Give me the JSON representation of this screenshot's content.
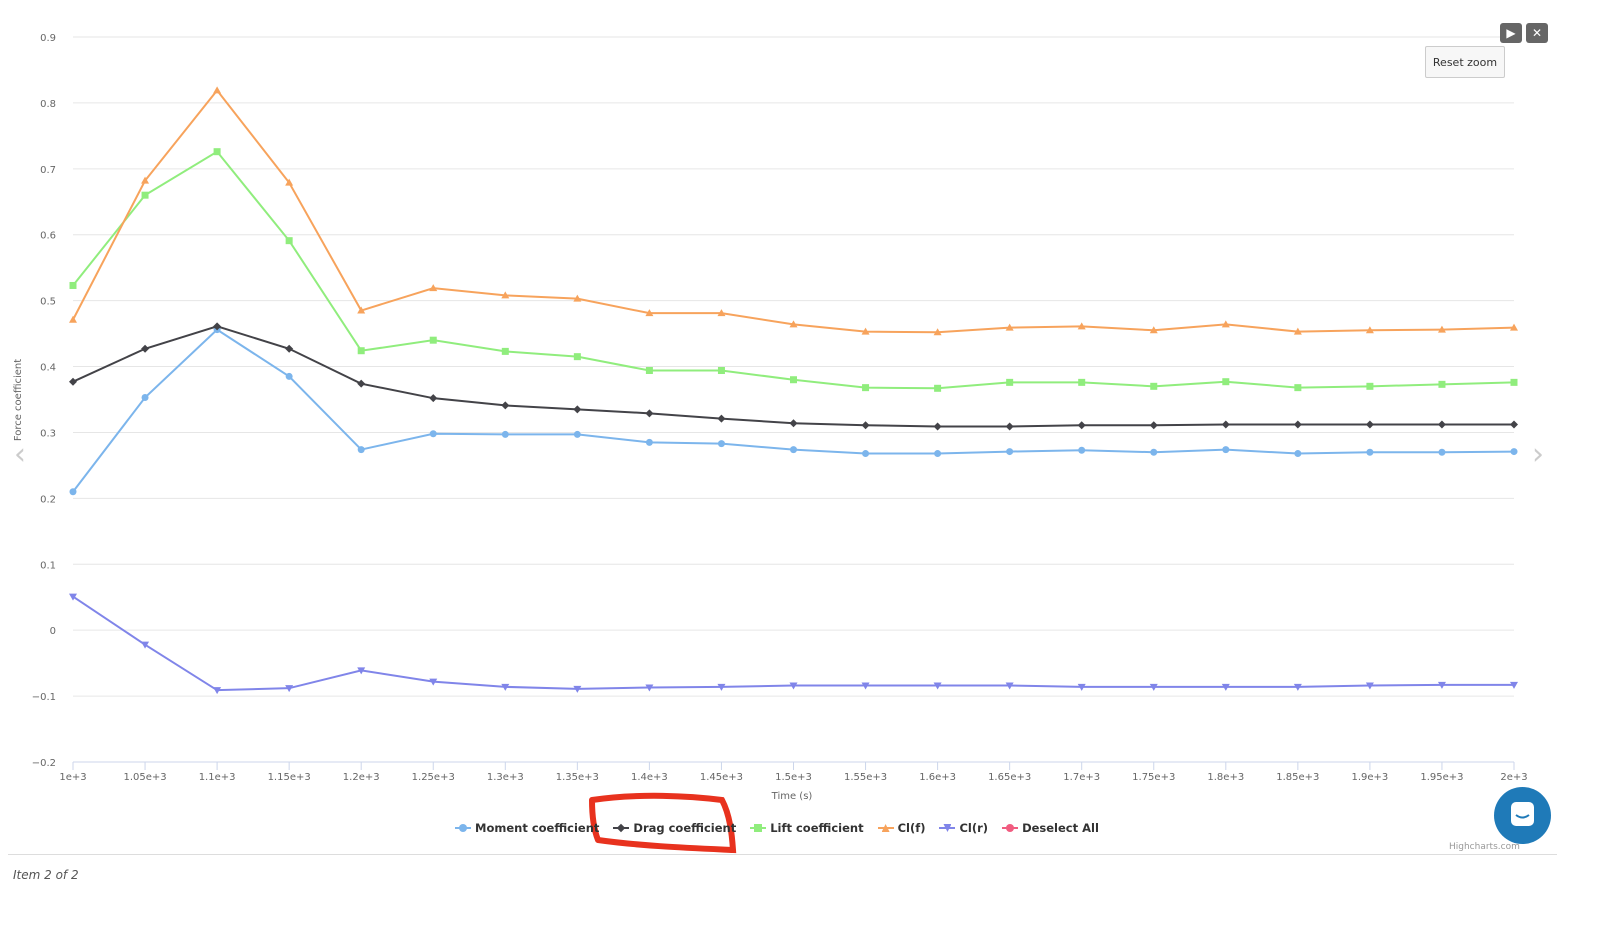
{
  "chart_data": {
    "type": "line",
    "title": "",
    "xlabel": "Time (s)",
    "ylabel": "Force coefficient",
    "xlim": [
      1000,
      2000
    ],
    "ylim": [
      -0.2,
      0.9
    ],
    "yticks": [
      -0.2,
      -0.1,
      0,
      0.1,
      0.2,
      0.3,
      0.4,
      0.5,
      0.6,
      0.7,
      0.8,
      0.9
    ],
    "ytick_labels": [
      "−0.2",
      "−0.1",
      "0",
      "0.1",
      "0.2",
      "0.3",
      "0.4",
      "0.5",
      "0.6",
      "0.7",
      "0.8",
      "0.9"
    ],
    "x": [
      1000,
      1050,
      1100,
      1150,
      1200,
      1250,
      1300,
      1350,
      1400,
      1450,
      1500,
      1550,
      1600,
      1650,
      1700,
      1750,
      1800,
      1850,
      1900,
      1950,
      2000
    ],
    "xtick_labels": [
      "1e+3",
      "1.05e+3",
      "1.1e+3",
      "1.15e+3",
      "1.2e+3",
      "1.25e+3",
      "1.3e+3",
      "1.35e+3",
      "1.4e+3",
      "1.45e+3",
      "1.5e+3",
      "1.55e+3",
      "1.6e+3",
      "1.65e+3",
      "1.7e+3",
      "1.75e+3",
      "1.8e+3",
      "1.85e+3",
      "1.9e+3",
      "1.95e+3",
      "2e+3"
    ],
    "grid": true,
    "legend_position": "bottom-center",
    "series": [
      {
        "name": "Moment coefficient",
        "color": "#7cb5ec",
        "marker": "circle",
        "values": [
          0.21,
          0.353,
          0.456,
          0.385,
          0.274,
          0.298,
          0.297,
          0.297,
          0.285,
          0.283,
          0.274,
          0.268,
          0.268,
          0.271,
          0.273,
          0.27,
          0.274,
          0.268,
          0.27,
          0.27,
          0.271
        ]
      },
      {
        "name": "Drag coefficient",
        "color": "#434348",
        "marker": "diamond",
        "values": [
          0.377,
          0.427,
          0.461,
          0.427,
          0.374,
          0.352,
          0.341,
          0.335,
          0.329,
          0.321,
          0.314,
          0.311,
          0.309,
          0.309,
          0.311,
          0.311,
          0.312,
          0.312,
          0.312,
          0.312,
          0.312
        ]
      },
      {
        "name": "Lift coefficient",
        "color": "#90ed7d",
        "marker": "square",
        "values": [
          0.523,
          0.66,
          0.726,
          0.591,
          0.424,
          0.44,
          0.423,
          0.415,
          0.394,
          0.394,
          0.38,
          0.368,
          0.367,
          0.376,
          0.376,
          0.37,
          0.377,
          0.368,
          0.37,
          0.373,
          0.376
        ]
      },
      {
        "name": "Cl(f)",
        "color": "#f7a35c",
        "marker": "triangle",
        "values": [
          0.471,
          0.682,
          0.819,
          0.679,
          0.485,
          0.519,
          0.508,
          0.503,
          0.481,
          0.481,
          0.464,
          0.453,
          0.452,
          0.459,
          0.461,
          0.455,
          0.464,
          0.453,
          0.455,
          0.456,
          0.459
        ]
      },
      {
        "name": "Cl(r)",
        "color": "#8085e9",
        "marker": "triangle-down",
        "values": [
          0.051,
          -0.022,
          -0.091,
          -0.088,
          -0.061,
          -0.078,
          -0.086,
          -0.089,
          -0.087,
          -0.086,
          -0.084,
          -0.084,
          -0.084,
          -0.084,
          -0.086,
          -0.086,
          -0.086,
          -0.086,
          -0.084,
          -0.083,
          -0.083
        ]
      }
    ],
    "extra_legend": {
      "name": "Deselect All",
      "color": "#f15c80"
    }
  },
  "ui": {
    "reset_zoom": "Reset zoom",
    "item_counter": "Item 2 of 2",
    "credit": "Highcharts.com",
    "annotation_color": "#e8321e"
  }
}
